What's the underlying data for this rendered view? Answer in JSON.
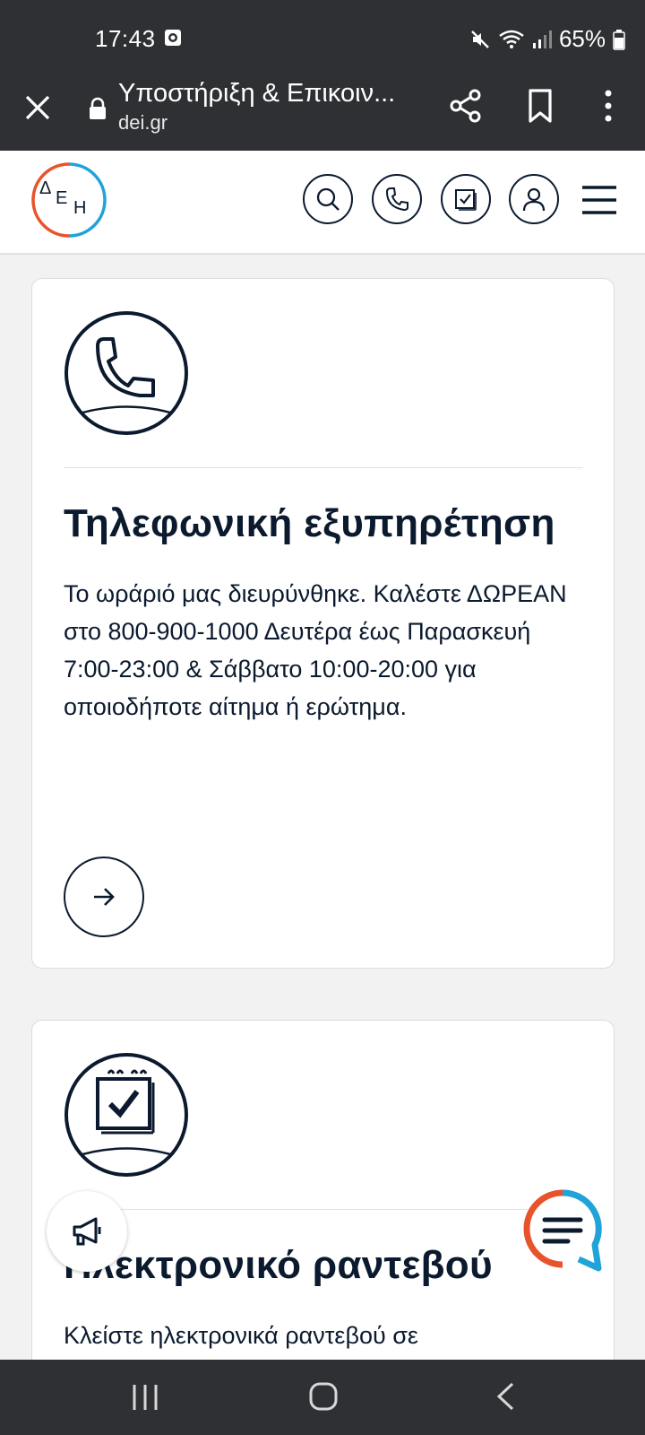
{
  "status_bar": {
    "time": "17:43",
    "battery": "65%"
  },
  "browser": {
    "page_title": "Υποστήριξη & Επικοιν...",
    "domain": "dei.gr"
  },
  "header": {
    "logo_text": "ΔΕΗ",
    "icons": [
      "search-icon",
      "phone-icon",
      "calendar-check-icon",
      "user-icon",
      "menu-icon"
    ]
  },
  "cards": [
    {
      "icon": "phone-icon",
      "title": "Τηλεφωνική εξυπηρέτηση",
      "body": "Το ωράριό μας διευρύνθηκε. Καλέστε ΔΩΡΕΑΝ στο 800-900-1000 Δευτέρα έως Παρασκευή 7:00-23:00 & Σάββατο 10:00-20:00 για οποιοδήποτε αίτημα ή ερώτημα.",
      "action_icon": "arrow-right-icon"
    },
    {
      "icon": "calendar-check-icon",
      "title": "Ηλεκτρονικό ραντεβού",
      "body": "Κλείστε ηλεκτρονικά ραντεβού σε"
    }
  ],
  "floating": {
    "left_icon": "megaphone-icon",
    "right_icon": "chat-icon"
  },
  "colors": {
    "brand_orange": "#e8532b",
    "brand_blue": "#1fa3d9",
    "navy": "#0b1a2e",
    "chrome_dark": "#2f3033"
  }
}
